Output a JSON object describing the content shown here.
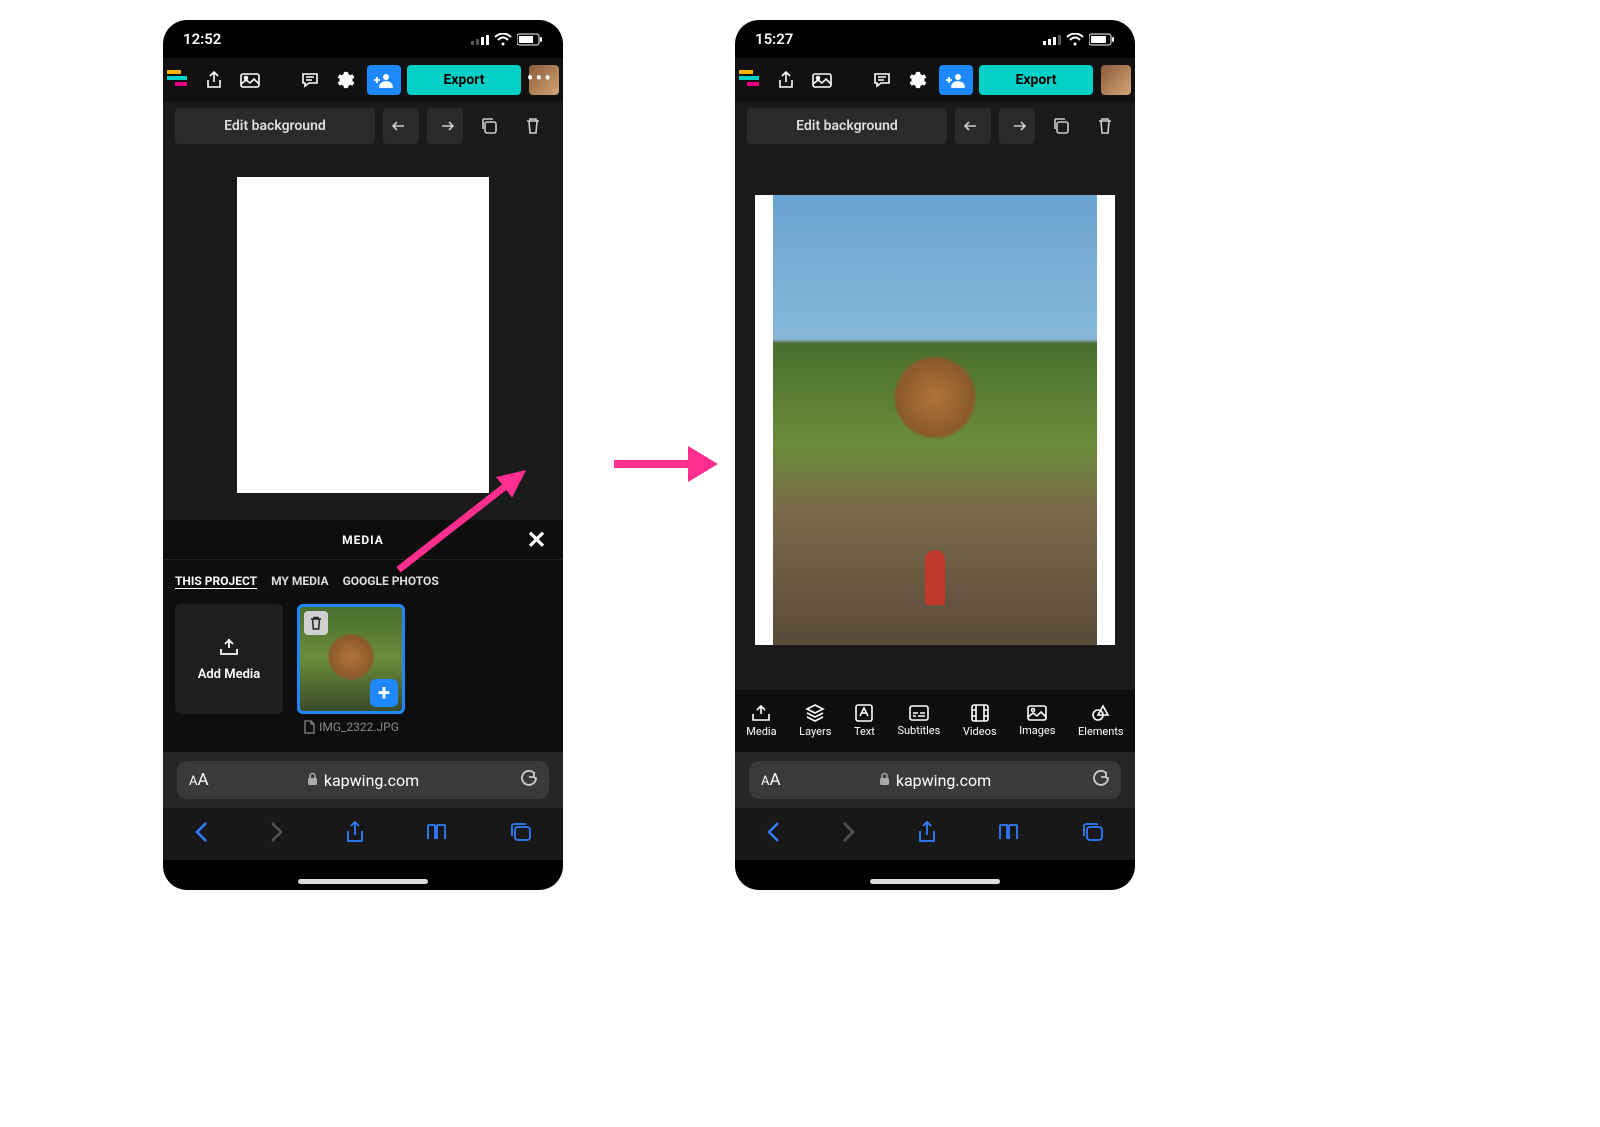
{
  "left": {
    "time": "12:52",
    "export_label": "Export",
    "edit_bg_label": "Edit background",
    "media_header": "MEDIA",
    "tabs": {
      "this_project": "THIS PROJECT",
      "my_media": "MY MEDIA",
      "google_photos": "GOOGLE PHOTOS"
    },
    "add_media_label": "Add Media",
    "thumb_filename": "IMG_2322.JPG",
    "url": "kapwing.com"
  },
  "right": {
    "time": "15:27",
    "export_label": "Export",
    "edit_bg_label": "Edit background",
    "toolnav": {
      "media": "Media",
      "layers": "Layers",
      "text": "Text",
      "subtitles": "Subtitles",
      "videos": "Videos",
      "images": "Images",
      "elements": "Elements"
    },
    "url": "kapwing.com"
  }
}
